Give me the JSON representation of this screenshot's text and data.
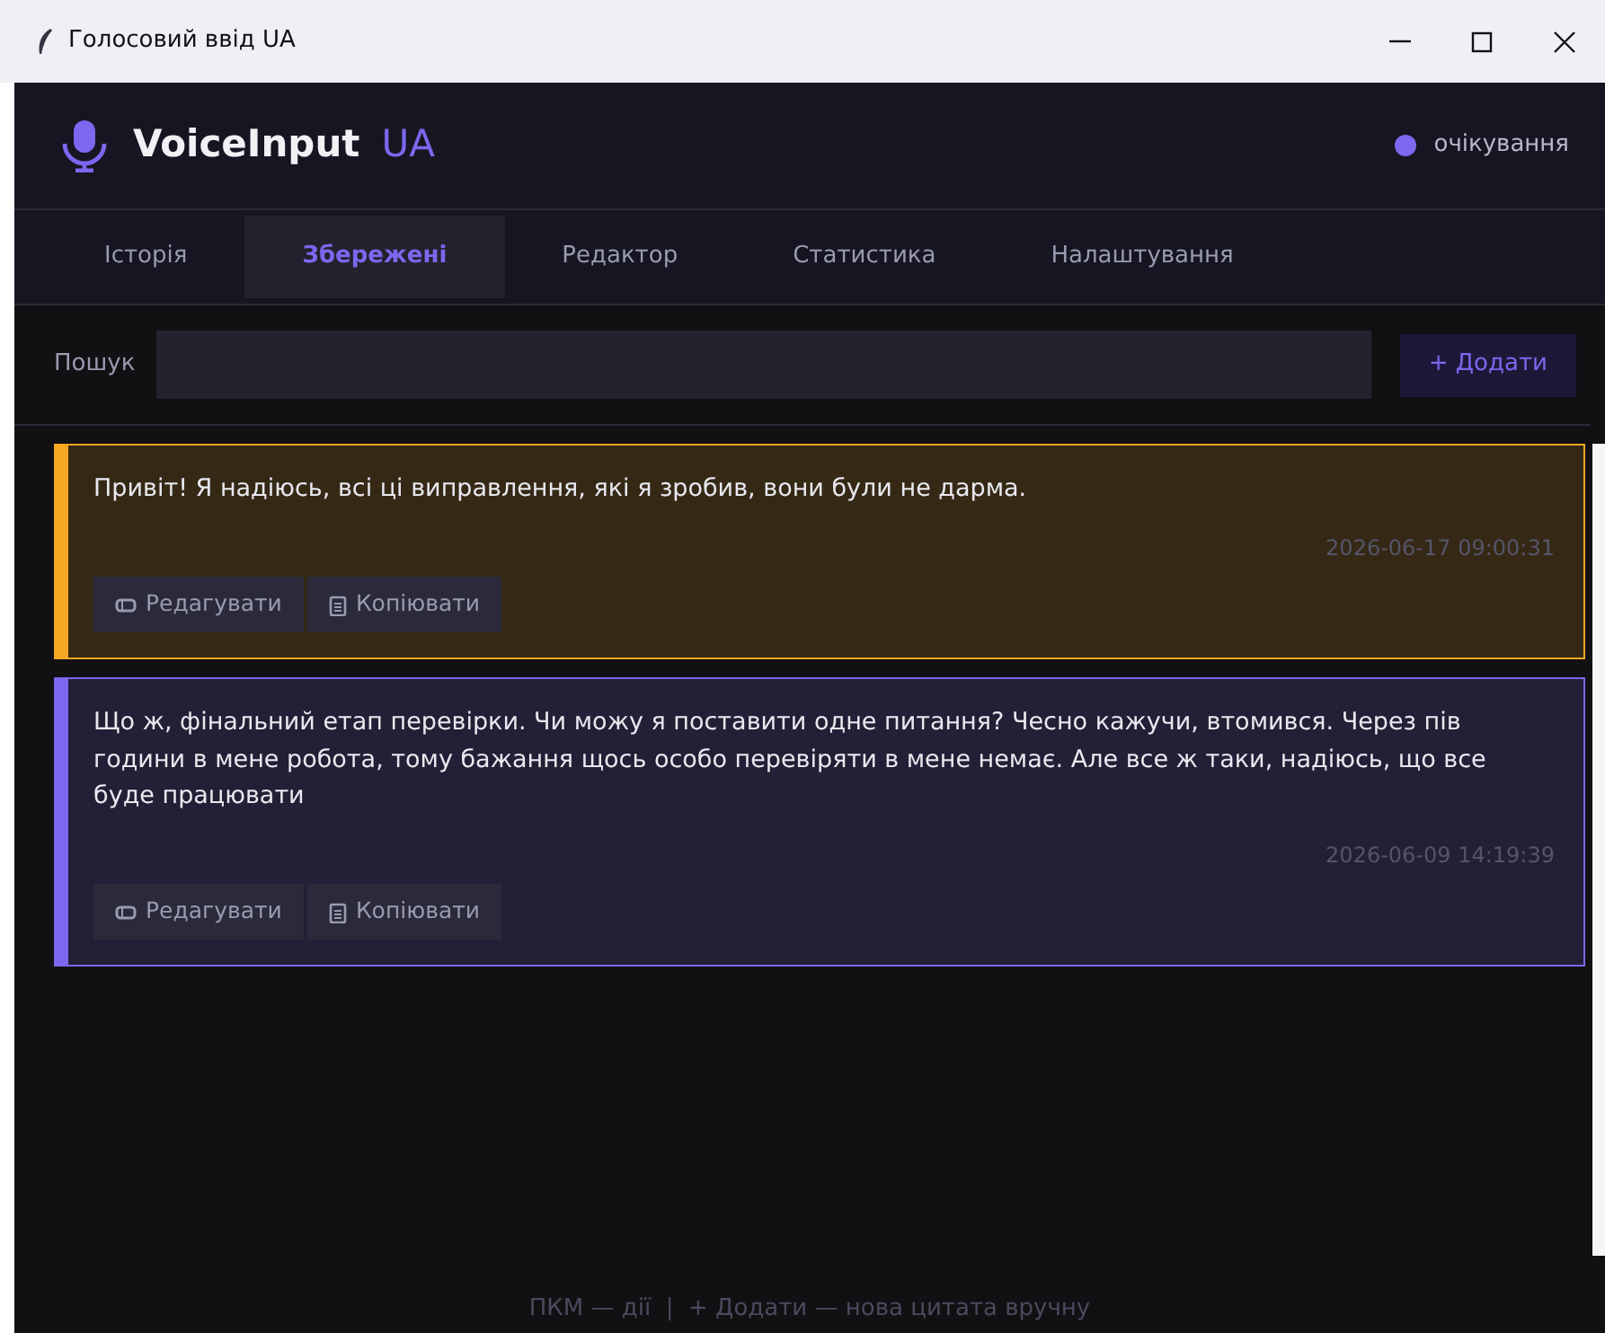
{
  "window": {
    "title": "Голосовий ввід UA"
  },
  "header": {
    "app_name": "VoiceInput",
    "app_suffix": "UA",
    "status": "очікування"
  },
  "tabs": [
    {
      "label": "Історія",
      "selected": false
    },
    {
      "label": "Збережені",
      "selected": true
    },
    {
      "label": "Редактор",
      "selected": false
    },
    {
      "label": "Статистика",
      "selected": false
    },
    {
      "label": "Налаштування",
      "selected": false
    }
  ],
  "search": {
    "label": "Пошук",
    "add_button": "+ Додати"
  },
  "quotes": [
    {
      "text": "Привіт! Я надіюсь, всі ці виправлення, які я зробив, вони були не дарма.",
      "time": "2026-06-17 09:00:31",
      "color": "#f5a623",
      "edit": "Редагувати",
      "copy": "Копіювати"
    },
    {
      "text": "Що ж, фінальний етап перевірки. Чи можу я поставити одне питання? Чесно кажучи, втомився. Через пів години в мене робота, тому бажання щось особо перевіряти в мене немає. Але все ж таки, надіюсь, що все буде працювати",
      "time": "2026-06-09 14:19:39",
      "color": "#7b68ee",
      "edit": "Редагувати",
      "copy": "Копіювати"
    }
  ],
  "footer": "ПКМ — дії  |  + Додати — нова цитата вручну"
}
